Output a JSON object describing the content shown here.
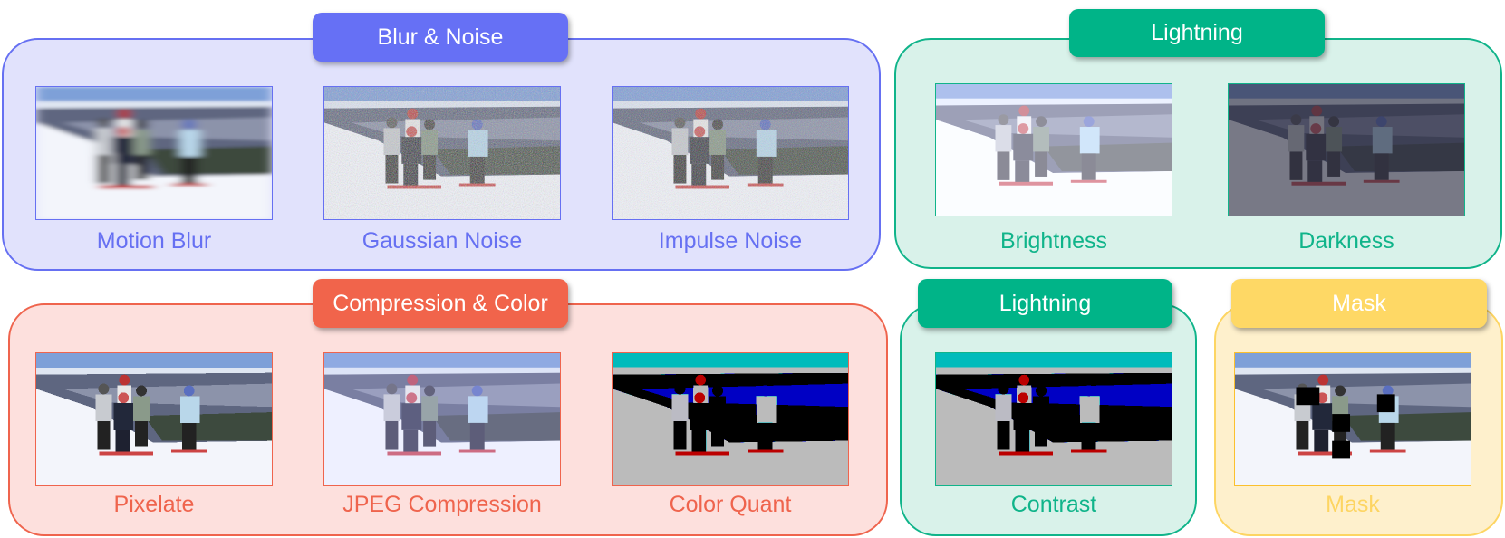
{
  "groups": {
    "blur_noise": {
      "title": "Blur & Noise",
      "color": "#6670f5",
      "items": [
        {
          "label": "Motion Blur",
          "effect": "motion-blur"
        },
        {
          "label": "Gaussian Noise",
          "effect": "gaussian-noise"
        },
        {
          "label": "Impulse Noise",
          "effect": "impulse-noise"
        }
      ]
    },
    "lightning_top": {
      "title": "Lightning",
      "color": "#00b488",
      "items": [
        {
          "label": "Brightness",
          "effect": "brightness"
        },
        {
          "label": "Darkness",
          "effect": "darkness"
        }
      ]
    },
    "compression_color": {
      "title": "Compression & Color",
      "color": "#f1644b",
      "items": [
        {
          "label": "Pixelate",
          "effect": "pixelate"
        },
        {
          "label": "JPEG Compression",
          "effect": "jpeg-compression"
        },
        {
          "label": "Color Quant",
          "effect": "color-quant"
        }
      ]
    },
    "lightning_bottom": {
      "title": "Lightning",
      "color": "#00b488",
      "items": [
        {
          "label": "Contrast",
          "effect": "contrast"
        }
      ]
    },
    "mask": {
      "title": "Mask",
      "color": "#fed865",
      "items": [
        {
          "label": "Mask",
          "effect": "mask"
        }
      ]
    }
  }
}
